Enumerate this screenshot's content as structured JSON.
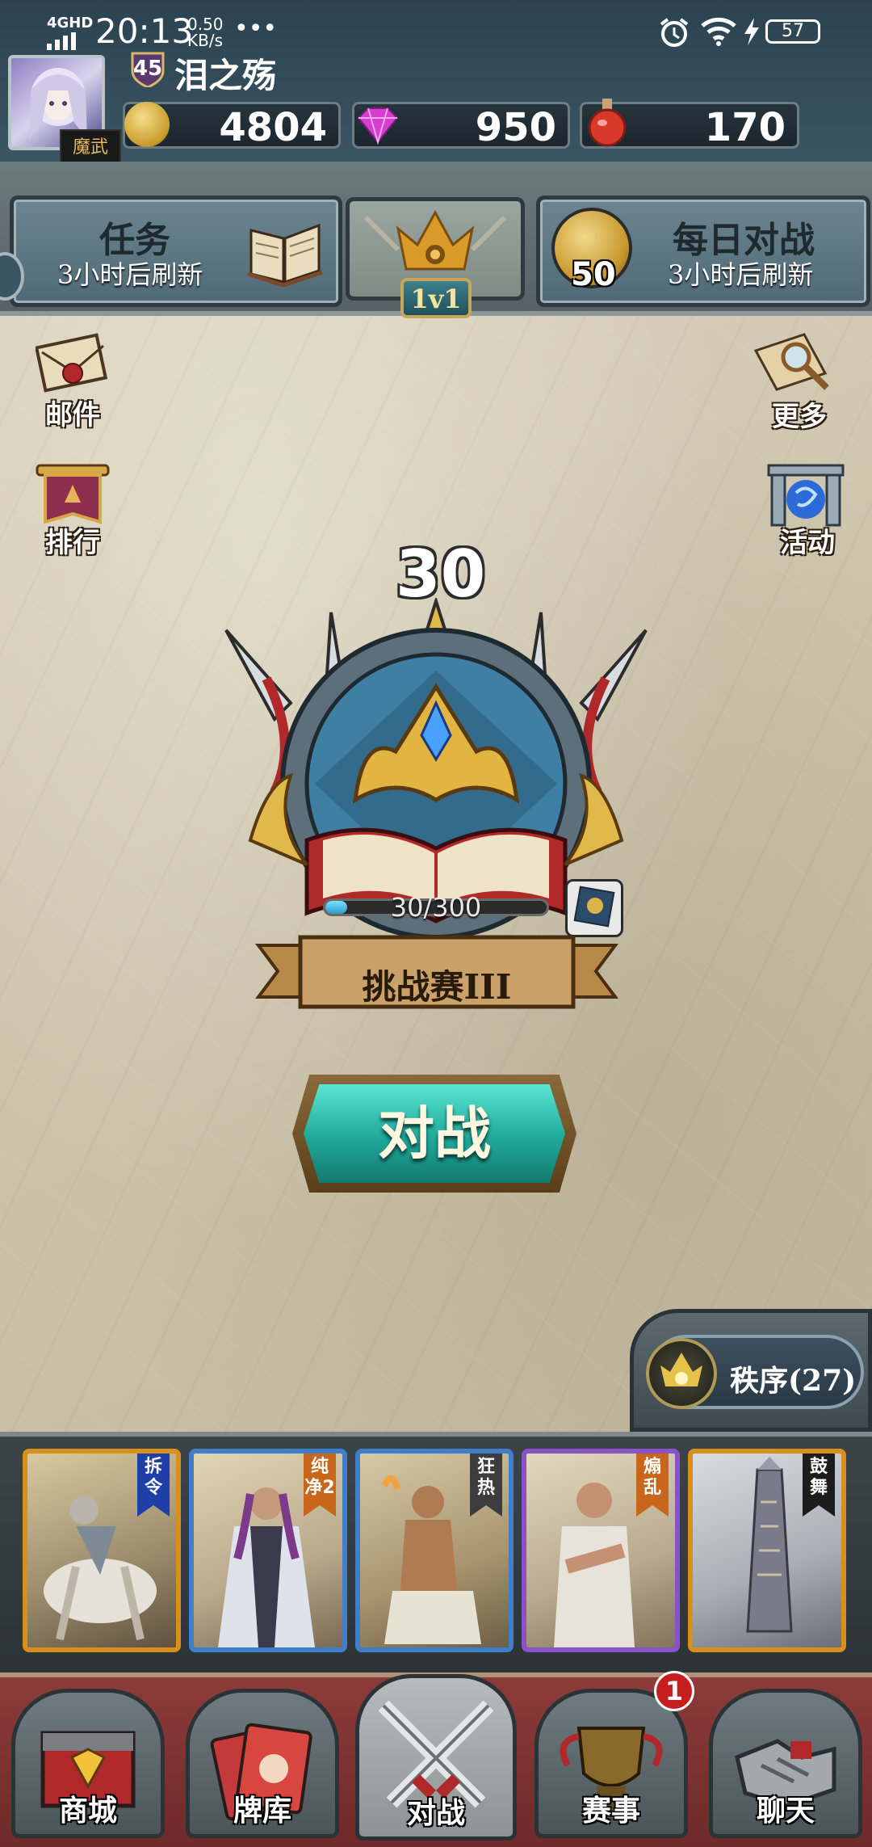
{
  "status_bar": {
    "network": "4GHD",
    "time": "20:13",
    "speed_value": "0.50",
    "speed_unit": "KB/s",
    "more": "•••",
    "battery": "57"
  },
  "player": {
    "level": "45",
    "name": "泪之殇",
    "guild_badge": "魔武 乱殿"
  },
  "resources": {
    "gold": "4804",
    "gems": "950",
    "potion": "170"
  },
  "top_buttons": {
    "tasks_title": "任务",
    "tasks_sub": "3小时后刷新",
    "mode_label": "1v1",
    "daily_title": "每日对战",
    "daily_sub": "3小时后刷新",
    "daily_coin": "50"
  },
  "side_buttons": {
    "mail": "邮件",
    "rank": "排行",
    "more": "更多",
    "event": "活动"
  },
  "rank_emblem": {
    "level": "30",
    "progress_text": "30/300",
    "progress_fraction": 0.1,
    "tier": "挑战赛III"
  },
  "battle_button": "对战",
  "faction": {
    "label": "秩序(27)"
  },
  "cards": [
    {
      "tag": "拆令",
      "tag_color": "#1f3fa8",
      "frame": "#d98f1c"
    },
    {
      "tag": "纯净2",
      "tag_color": "#c8661c",
      "frame": "#3f7fc9"
    },
    {
      "tag": "狂热",
      "tag_color": "#3d3d3d",
      "frame": "#3f7fc9"
    },
    {
      "tag": "煽乱",
      "tag_color": "#c8661c",
      "frame": "#8a52c9"
    },
    {
      "tag": "鼓舞",
      "tag_color": "#1c1c1c",
      "frame": "#d98f1c"
    }
  ],
  "nav": {
    "shop": "商城",
    "deck": "牌库",
    "battle": "对战",
    "events": "赛事",
    "events_badge": "1",
    "chat": "聊天"
  }
}
